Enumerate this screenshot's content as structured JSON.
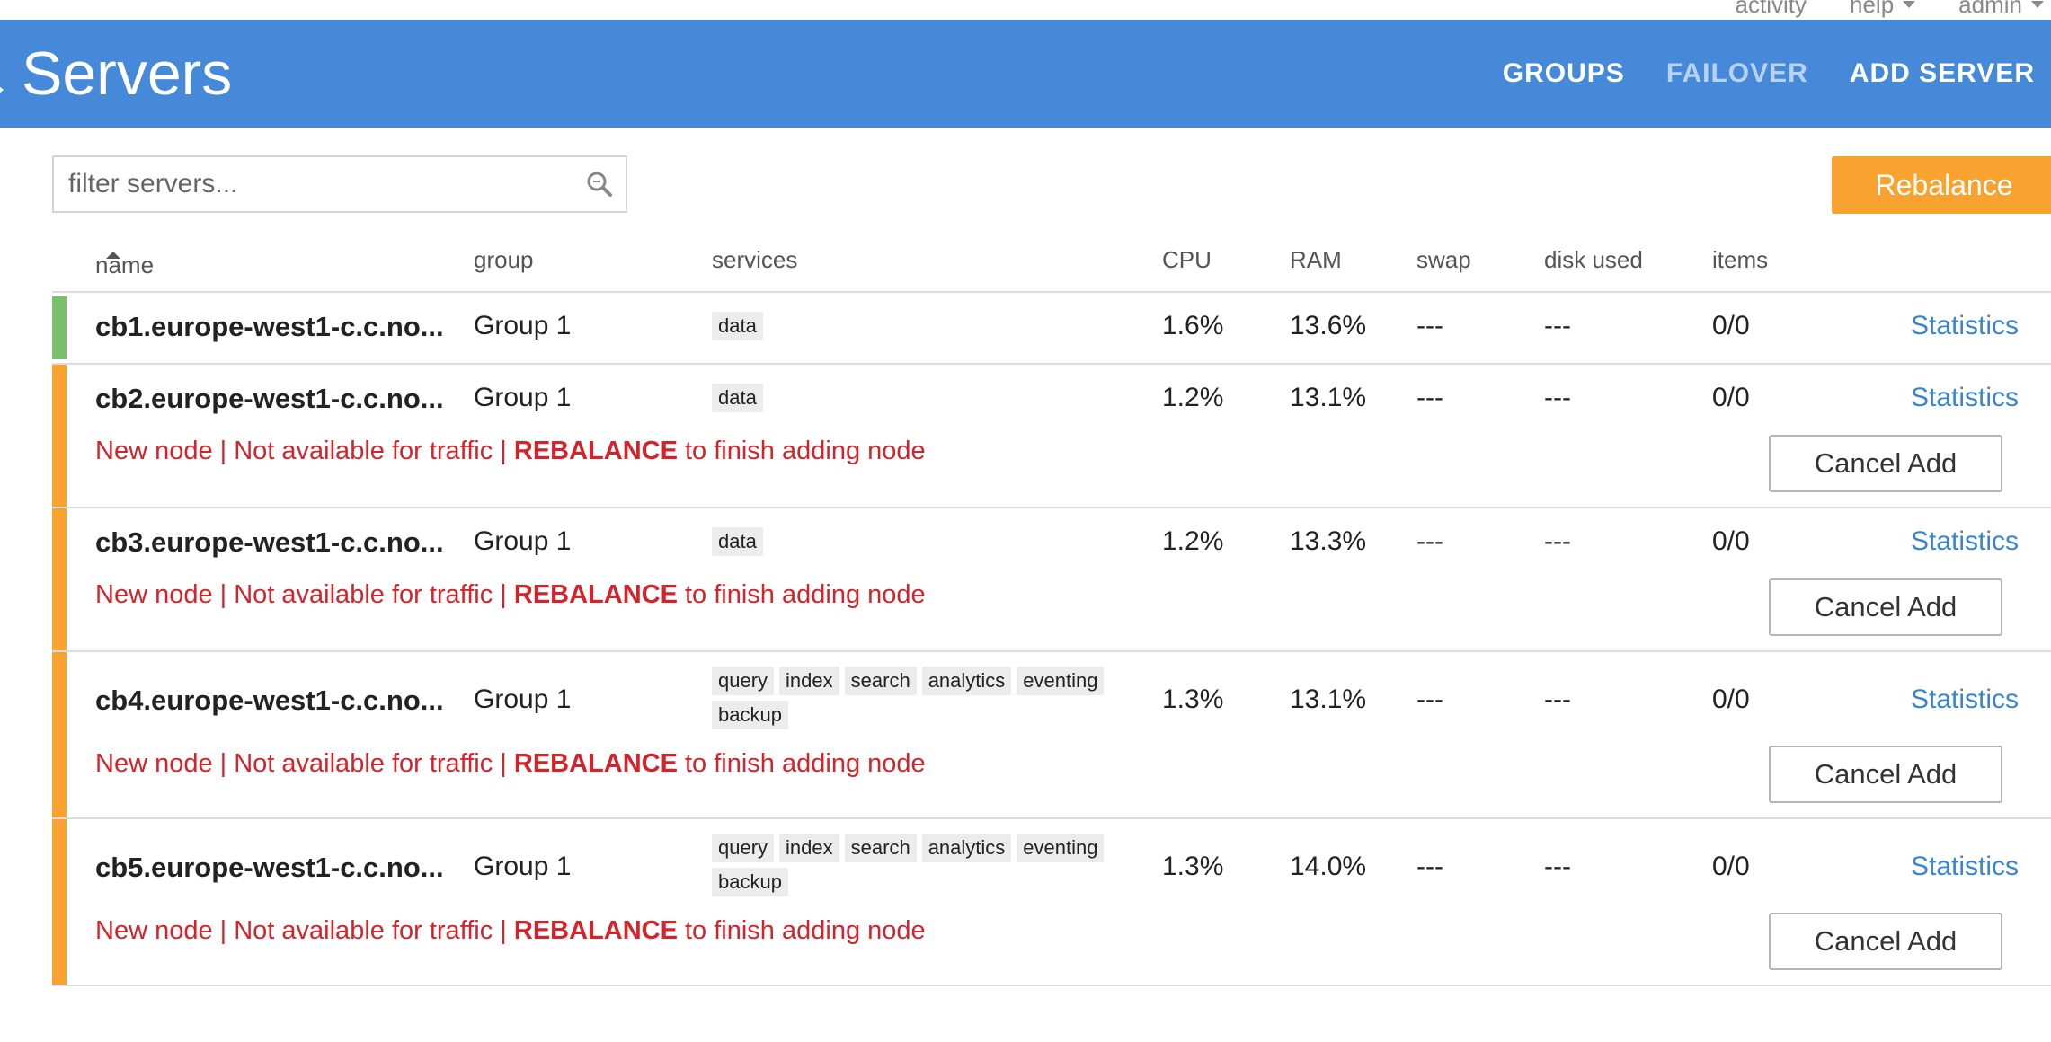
{
  "toplinks": {
    "activity": "activity",
    "help": "help",
    "admin": "admin"
  },
  "header": {
    "title": "Servers",
    "nav": {
      "groups": "GROUPS",
      "failover": "FAILOVER",
      "add_server": "ADD SERVER"
    }
  },
  "filter": {
    "placeholder": "filter servers..."
  },
  "rebalance_label": "Rebalance",
  "columns": {
    "name": "name",
    "group": "group",
    "services": "services",
    "cpu": "CPU",
    "ram": "RAM",
    "swap": "swap",
    "disk": "disk used",
    "items": "items"
  },
  "warning": {
    "prefix": "New node | Not available for traffic | ",
    "strong": "REBALANCE",
    "suffix": " to finish adding node"
  },
  "cancel_label": "Cancel Add",
  "stats_label": "Statistics",
  "servers": [
    {
      "name": "cb1.europe-west1-c.c.no...",
      "group": "Group 1",
      "services": [
        "data"
      ],
      "cpu": "1.6%",
      "ram": "13.6%",
      "swap": "---",
      "disk": "---",
      "items": "0/0",
      "status": "active"
    },
    {
      "name": "cb2.europe-west1-c.c.no...",
      "group": "Group 1",
      "services": [
        "data"
      ],
      "cpu": "1.2%",
      "ram": "13.1%",
      "swap": "---",
      "disk": "---",
      "items": "0/0",
      "status": "pending"
    },
    {
      "name": "cb3.europe-west1-c.c.no...",
      "group": "Group 1",
      "services": [
        "data"
      ],
      "cpu": "1.2%",
      "ram": "13.3%",
      "swap": "---",
      "disk": "---",
      "items": "0/0",
      "status": "pending"
    },
    {
      "name": "cb4.europe-west1-c.c.no...",
      "group": "Group 1",
      "services": [
        "query",
        "index",
        "search",
        "analytics",
        "eventing",
        "backup"
      ],
      "cpu": "1.3%",
      "ram": "13.1%",
      "swap": "---",
      "disk": "---",
      "items": "0/0",
      "status": "pending"
    },
    {
      "name": "cb5.europe-west1-c.c.no...",
      "group": "Group 1",
      "services": [
        "query",
        "index",
        "search",
        "analytics",
        "eventing",
        "backup"
      ],
      "cpu": "1.3%",
      "ram": "14.0%",
      "swap": "---",
      "disk": "---",
      "items": "0/0",
      "status": "pending"
    }
  ],
  "colors": {
    "header": "#4689d9",
    "rebalance": "#f8a32f",
    "active_stripe": "#7ac06e",
    "pending_stripe": "#f8a32f",
    "warning_text": "#d4242b",
    "link": "#3b85cf"
  }
}
